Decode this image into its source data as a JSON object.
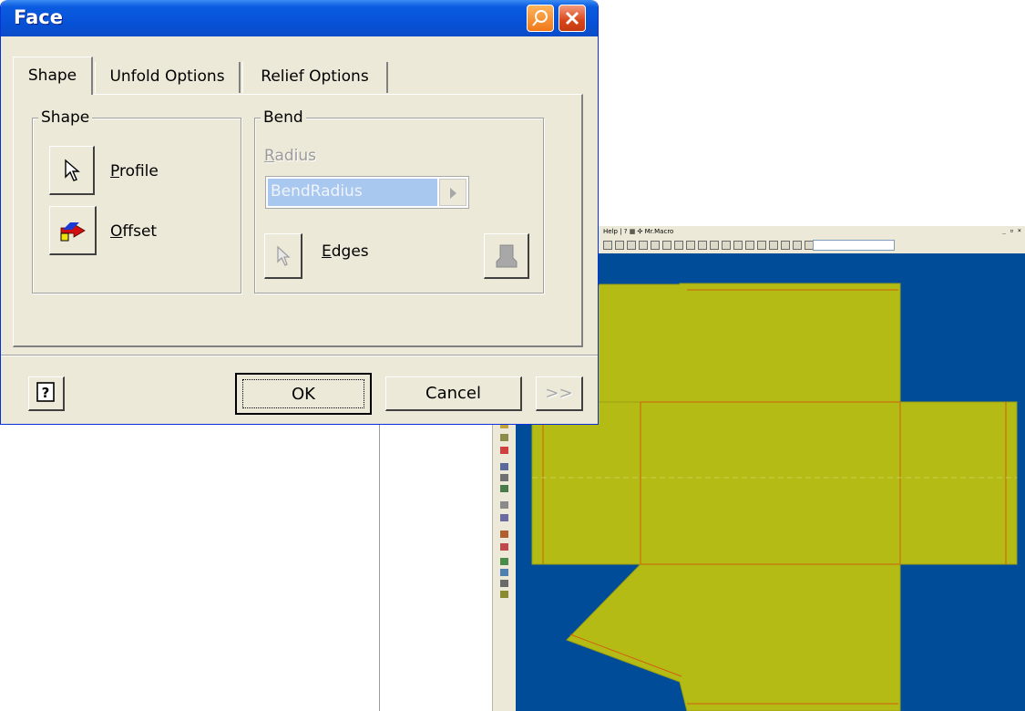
{
  "dialog": {
    "title": "Face",
    "tabs": [
      {
        "label": "Shape",
        "active": true
      },
      {
        "label": "Unfold Options",
        "active": false
      },
      {
        "label": "Relief Options",
        "active": false
      }
    ],
    "shape_group": {
      "label": "Shape",
      "profile": {
        "hotkey": "P",
        "rest": "rofile",
        "icon": "select-arrow-icon"
      },
      "offset": {
        "hotkey": "O",
        "rest": "ffset",
        "icon": "offset-flip-icon"
      }
    },
    "bend_group": {
      "label": "Bend",
      "radius": {
        "hotkey": "R",
        "rest": "adius"
      },
      "radius_value": "BendRadius",
      "edges": {
        "hotkey": "E",
        "rest": "dges",
        "icon": "select-arrow-icon"
      },
      "side_icon": "sheet-bend-icon"
    },
    "buttons": {
      "help_icon": "help-question-icon",
      "ok": "OK",
      "cancel": "Cancel",
      "more": ">>"
    },
    "title_icons": {
      "pin": "pin-icon",
      "close": "close-icon"
    }
  },
  "background_app": {
    "menu_text": "Help  |  ?  ▦  ✣  Mr.Macro",
    "window_controls": "_ ▫ ×",
    "viewport_color": "#004c99",
    "part_color": "#b5bb15",
    "bend_line_color": "#d06010"
  }
}
